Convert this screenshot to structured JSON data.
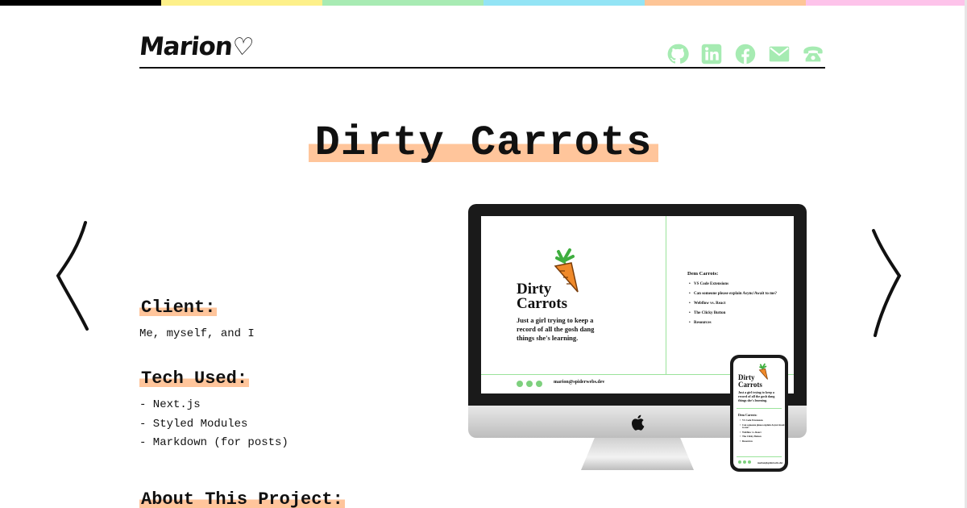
{
  "colors": {
    "rainbow": [
      "#000000",
      "#fdf08a",
      "#a8ebb3",
      "#93e4f5",
      "#fdc597",
      "#fdc3ea"
    ],
    "highlight": "#ffc59b",
    "social_icon": "#a6ebb2"
  },
  "header": {
    "logo": "Marion",
    "socials": [
      {
        "icon": "github-icon"
      },
      {
        "icon": "linkedin-icon"
      },
      {
        "icon": "facebook-icon"
      },
      {
        "icon": "email-icon"
      },
      {
        "icon": "phone-icon"
      }
    ]
  },
  "project": {
    "title": "Dirty Carrots",
    "client_heading": "Client:",
    "client_value": "Me, myself, and I",
    "tech_heading": "Tech Used:",
    "tech_items": [
      "- Next.js",
      "- Styled Modules",
      "- Markdown (for posts)"
    ],
    "about_heading": "About This Project:"
  },
  "mockup": {
    "site_title_line1": "Dirty",
    "site_title_line2": "Carrots",
    "tagline": "Just a girl trying to keep a record of all the gosh dang things she's learning.",
    "sidebar_title": "Dem Carrots:",
    "sidebar_items": [
      "VS Code Extensions",
      "Can someone please explain Async/Await to me?",
      "Webflow vs. React",
      "The Clicky Button",
      "Resources"
    ],
    "email": "marion@spiderwebs.dev"
  }
}
